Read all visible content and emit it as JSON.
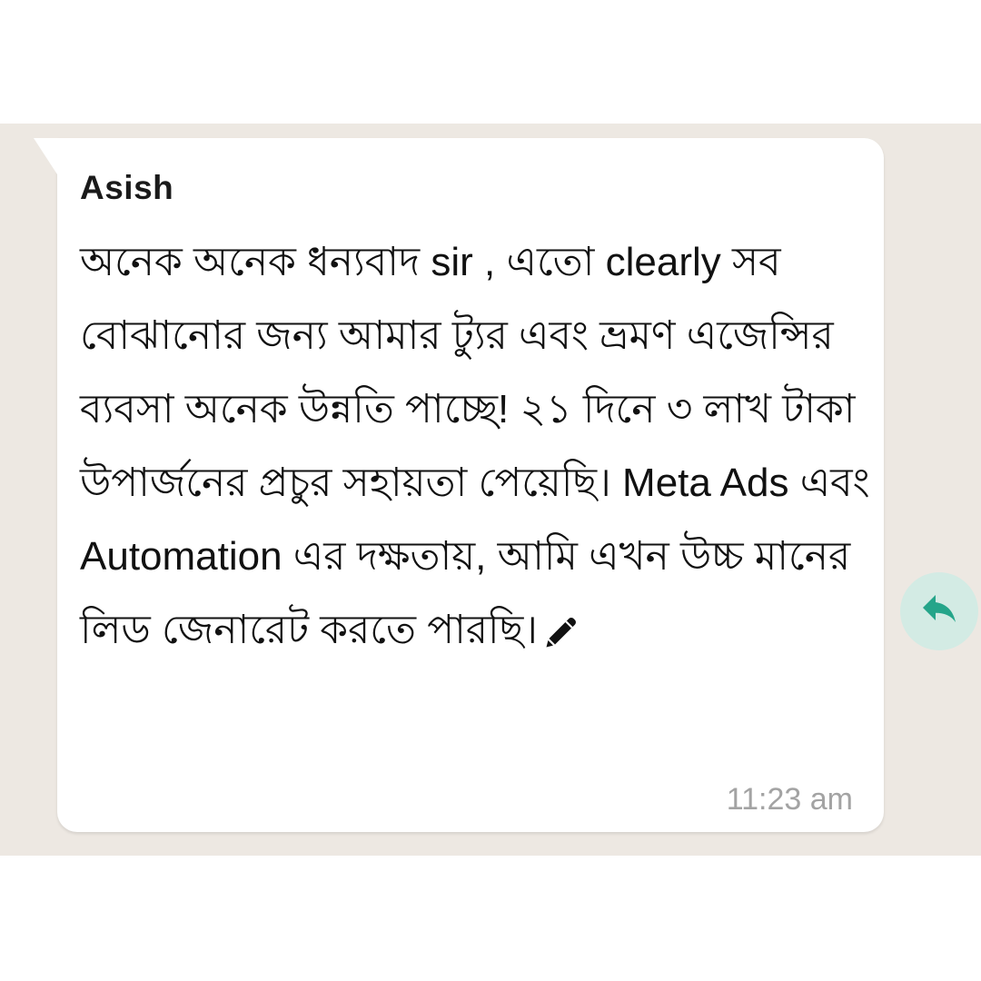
{
  "message": {
    "sender": "Asish",
    "text": " অনেক অনেক ধন্যবাদ sir , এতো clearly  সব বোঝানোর জন্য  আমার ট্যুর এবং ভ্রমণ এজেন্সির ব্যবসা অনেক উন্নতি পাচ্ছে! ২১ দিনে ৩ লাখ টাকা উপার্জনের প্রচুর সহায়তা পেয়েছি। Meta Ads এবং Automation এর দক্ষতায়, আমি এখন উচ্চ মানের লিড জেনারেট করতে পারছি।",
    "trailing_icon": "pencil-icon",
    "time": "11:23 am"
  },
  "actions": {
    "reply_icon": "reply-arrow-icon"
  },
  "colors": {
    "chat_background": "#ede8e2",
    "bubble": "#ffffff",
    "reply_button": "#d3ebe4",
    "reply_arrow": "#25a58a",
    "timestamp": "#a3a3a3"
  }
}
